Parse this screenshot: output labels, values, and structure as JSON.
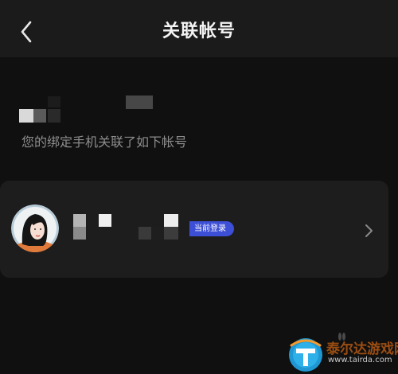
{
  "header": {
    "back_icon": "chevron-left-icon",
    "title": "关联帐号"
  },
  "main": {
    "masked_phone": "",
    "subtitle": "您的绑定手机关联了如下帐号"
  },
  "accounts": [
    {
      "avatar_icon": "avatar-illustration",
      "masked_name": "",
      "badge": "当前登录",
      "chevron_icon": "chevron-right-icon"
    }
  ],
  "watermark": {
    "text": "泰尔达游戏网",
    "url": "www.tairda.com"
  },
  "colors": {
    "background": "#101010",
    "header": "#1b1b1b",
    "card": "#1d1d1d",
    "badge": "#3d4fd6",
    "subtitle": "#8d8d8d"
  }
}
